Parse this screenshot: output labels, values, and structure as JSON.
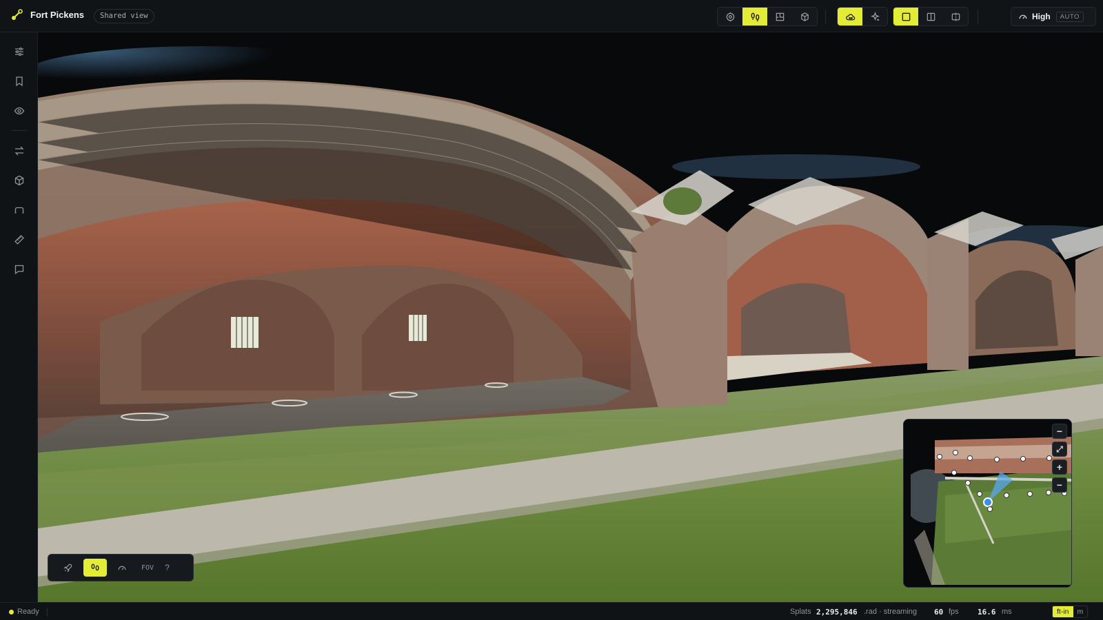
{
  "app": {
    "title": "Fort Pickens",
    "shared_chip": "Shared view"
  },
  "toolbar": {
    "group1": [
      {
        "icon": "orbit-icon",
        "active": false
      },
      {
        "icon": "walk-icon",
        "active": true
      },
      {
        "icon": "floorplan-icon",
        "active": false
      },
      {
        "icon": "cube-icon",
        "active": false
      }
    ],
    "group2": [
      {
        "icon": "cloud-view-icon",
        "active": true
      },
      {
        "icon": "sparkle-icon",
        "active": false
      }
    ],
    "group3": [
      {
        "icon": "single-view-icon",
        "active": true
      },
      {
        "icon": "split-view-icon",
        "active": false
      },
      {
        "icon": "compare-view-icon",
        "active": false
      }
    ],
    "quality": {
      "label": "High",
      "mode": "AUTO"
    }
  },
  "sidebar": {
    "items": [
      {
        "icon": "sliders-icon"
      },
      {
        "icon": "bookmark-icon"
      },
      {
        "icon": "eye-icon"
      },
      {
        "icon": "swap-icon"
      },
      {
        "icon": "box-icon"
      },
      {
        "icon": "path-icon"
      },
      {
        "icon": "ruler-icon"
      },
      {
        "icon": "comment-icon"
      }
    ]
  },
  "nav_controls": {
    "fov_label": "FOV",
    "help_label": "?"
  },
  "minimap": {
    "buttons": [
      "−",
      "⤢",
      "+",
      "−"
    ]
  },
  "status": {
    "state": "Ready",
    "splats_label": "Splats",
    "splats_value": "2,295,846",
    "format": ".rad · streaming",
    "fps_value": "60",
    "fps_unit": "fps",
    "ms_value": "16.6",
    "ms_unit": "ms",
    "units": [
      "ft-in",
      "m"
    ],
    "active_unit": "ft-in"
  },
  "colors": {
    "accent": "#e4ec36",
    "background": "#0b0d10",
    "panel": "#111417"
  }
}
